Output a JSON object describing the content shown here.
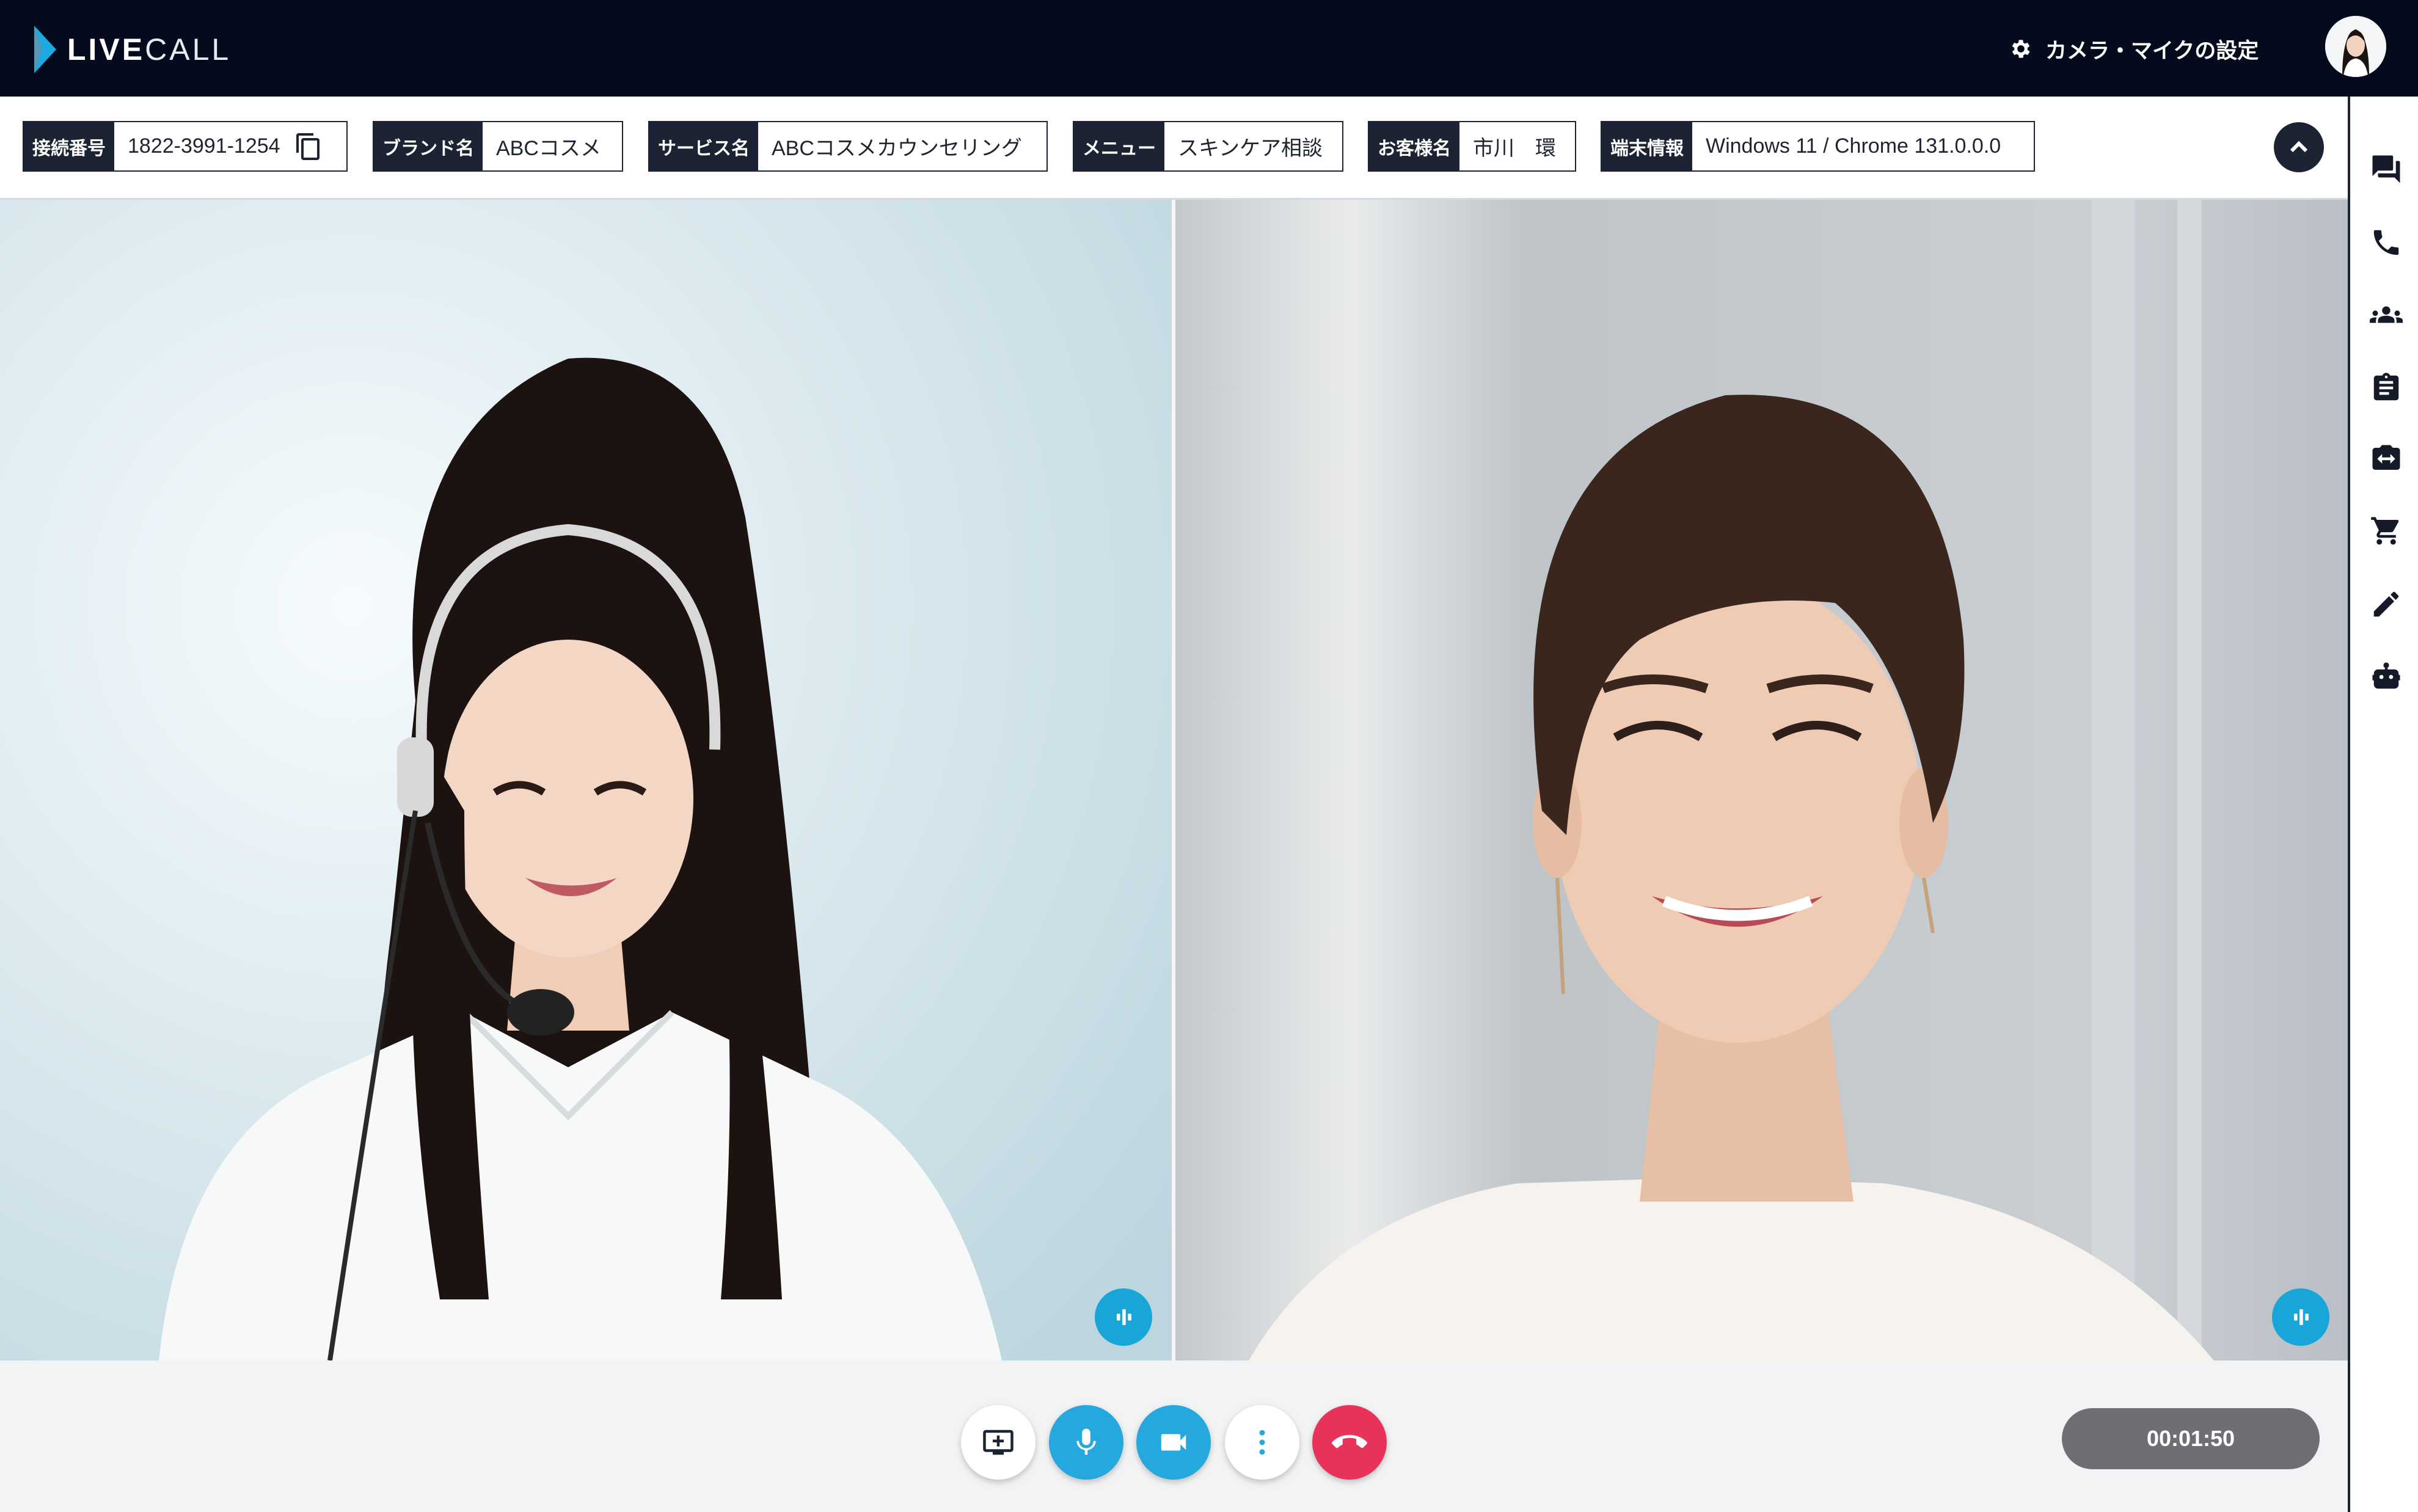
{
  "header": {
    "brand_bold": "LIVE",
    "brand_light": "CALL",
    "settings_label": "カメラ・マイクの設定"
  },
  "info": [
    {
      "label": "接続番号",
      "value": "1822-3991-1254"
    },
    {
      "label": "ブランド名",
      "value": "ABCコスメ"
    },
    {
      "label": "サービス名",
      "value": "ABCコスメカウンセリング"
    },
    {
      "label": "メニュー",
      "value": "スキンケア相談"
    },
    {
      "label": "お客様名",
      "value": "市川　環"
    },
    {
      "label": "端末情報",
      "value": "Windows 11 / Chrome 131.0.0.0"
    }
  ],
  "rail": {
    "icons": [
      "chat-icon",
      "phone-icon",
      "group-icon",
      "clipboard-icon",
      "camera-switch-icon",
      "cart-icon",
      "pencil-icon",
      "robot-icon"
    ]
  },
  "controls": {
    "timer": "00:01:50"
  },
  "colors": {
    "header_bg": "#030b1d",
    "accent_blue": "#24a8dd",
    "hangup_red": "#e9325a",
    "label_dark": "#1c2433"
  }
}
